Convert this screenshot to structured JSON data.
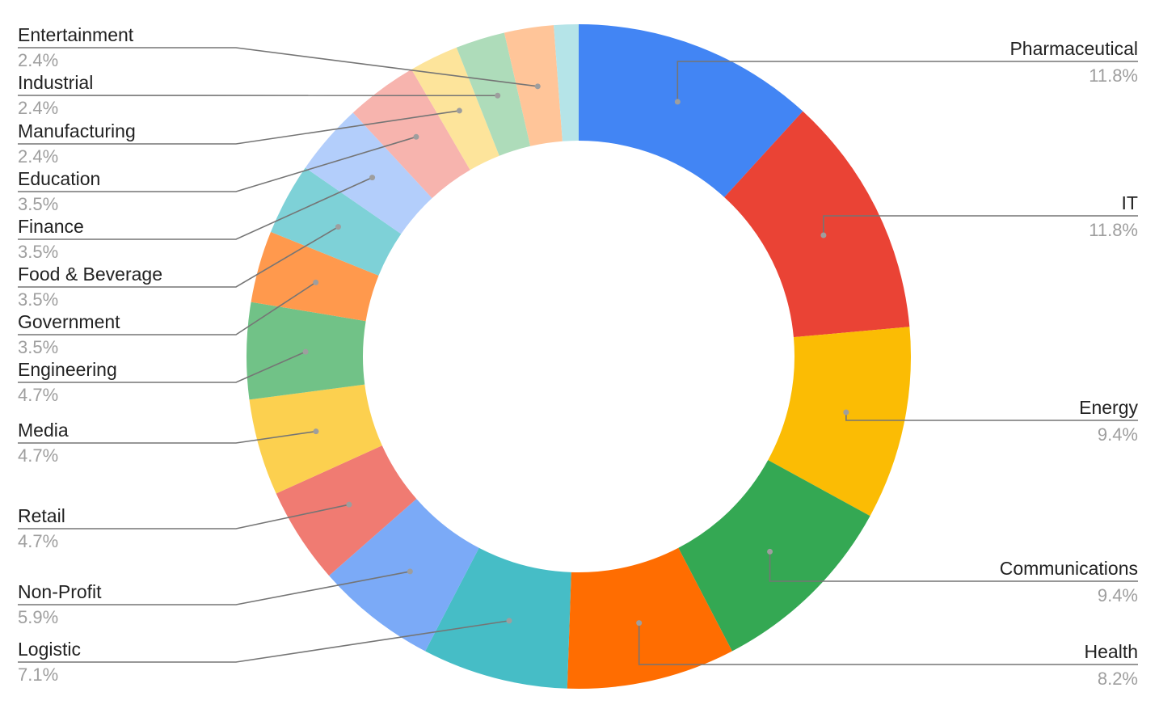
{
  "chart_data": {
    "type": "pie",
    "subtype": "donut",
    "title": "",
    "start_angle": "12 o'clock",
    "direction": "clockwise",
    "legend": "none (leader-line labels)",
    "slices": [
      {
        "label": "Pharmaceutical",
        "percent": 11.8,
        "display": "11.8%",
        "color": "#4285F4",
        "side": "right"
      },
      {
        "label": "IT",
        "percent": 11.8,
        "display": "11.8%",
        "color": "#EA4335",
        "side": "right"
      },
      {
        "label": "Energy",
        "percent": 9.4,
        "display": "9.4%",
        "color": "#FBBC04",
        "side": "right"
      },
      {
        "label": "Communications",
        "percent": 9.4,
        "display": "9.4%",
        "color": "#34A853",
        "side": "right"
      },
      {
        "label": "Health",
        "percent": 8.2,
        "display": "8.2%",
        "color": "#FF6D01",
        "side": "right"
      },
      {
        "label": "Logistic",
        "percent": 7.1,
        "display": "7.1%",
        "color": "#46BDC6",
        "side": "left"
      },
      {
        "label": "Non-Profit",
        "percent": 5.9,
        "display": "5.9%",
        "color": "#7BAAF7",
        "side": "left"
      },
      {
        "label": "Retail",
        "percent": 4.7,
        "display": "4.7%",
        "color": "#F07B72",
        "side": "left"
      },
      {
        "label": "Media",
        "percent": 4.7,
        "display": "4.7%",
        "color": "#FCD04F",
        "side": "left"
      },
      {
        "label": "Engineering",
        "percent": 4.7,
        "display": "4.7%",
        "color": "#71C287",
        "side": "left"
      },
      {
        "label": "Government",
        "percent": 3.5,
        "display": "3.5%",
        "color": "#FF994D",
        "side": "left"
      },
      {
        "label": "Food & Beverage",
        "percent": 3.5,
        "display": "3.5%",
        "color": "#7ED1D7",
        "side": "left"
      },
      {
        "label": "Finance",
        "percent": 3.5,
        "display": "3.5%",
        "color": "#B3CEFB",
        "side": "left"
      },
      {
        "label": "Education",
        "percent": 3.5,
        "display": "3.5%",
        "color": "#F7B4AE",
        "side": "left"
      },
      {
        "label": "Manufacturing",
        "percent": 2.4,
        "display": "2.4%",
        "color": "#FDE49B",
        "side": "left"
      },
      {
        "label": "Industrial",
        "percent": 2.4,
        "display": "2.4%",
        "color": "#AEDCBA",
        "side": "left"
      },
      {
        "label": "Entertainment",
        "percent": 2.4,
        "display": "2.4%",
        "color": "#FFC599",
        "side": "left"
      },
      {
        "label": "",
        "percent": 1.2,
        "display": "",
        "color": "#B5E4E8",
        "side": "none"
      }
    ]
  }
}
